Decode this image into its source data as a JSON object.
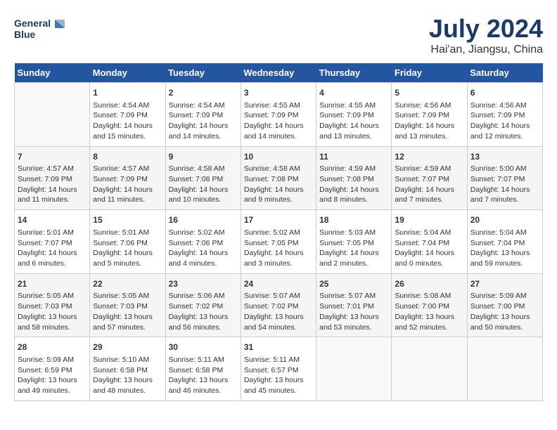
{
  "header": {
    "logo_line1": "General",
    "logo_line2": "Blue",
    "main_title": "July 2024",
    "subtitle": "Hai'an, Jiangsu, China"
  },
  "days_of_week": [
    "Sunday",
    "Monday",
    "Tuesday",
    "Wednesday",
    "Thursday",
    "Friday",
    "Saturday"
  ],
  "weeks": [
    [
      {
        "day": "",
        "content": ""
      },
      {
        "day": "1",
        "content": "Sunrise: 4:54 AM\nSunset: 7:09 PM\nDaylight: 14 hours and 15 minutes."
      },
      {
        "day": "2",
        "content": "Sunrise: 4:54 AM\nSunset: 7:09 PM\nDaylight: 14 hours and 14 minutes."
      },
      {
        "day": "3",
        "content": "Sunrise: 4:55 AM\nSunset: 7:09 PM\nDaylight: 14 hours and 14 minutes."
      },
      {
        "day": "4",
        "content": "Sunrise: 4:55 AM\nSunset: 7:09 PM\nDaylight: 14 hours and 13 minutes."
      },
      {
        "day": "5",
        "content": "Sunrise: 4:56 AM\nSunset: 7:09 PM\nDaylight: 14 hours and 13 minutes."
      },
      {
        "day": "6",
        "content": "Sunrise: 4:56 AM\nSunset: 7:09 PM\nDaylight: 14 hours and 12 minutes."
      }
    ],
    [
      {
        "day": "7",
        "content": "Sunrise: 4:57 AM\nSunset: 7:09 PM\nDaylight: 14 hours and 11 minutes."
      },
      {
        "day": "8",
        "content": "Sunrise: 4:57 AM\nSunset: 7:09 PM\nDaylight: 14 hours and 11 minutes."
      },
      {
        "day": "9",
        "content": "Sunrise: 4:58 AM\nSunset: 7:08 PM\nDaylight: 14 hours and 10 minutes."
      },
      {
        "day": "10",
        "content": "Sunrise: 4:58 AM\nSunset: 7:08 PM\nDaylight: 14 hours and 9 minutes."
      },
      {
        "day": "11",
        "content": "Sunrise: 4:59 AM\nSunset: 7:08 PM\nDaylight: 14 hours and 8 minutes."
      },
      {
        "day": "12",
        "content": "Sunrise: 4:59 AM\nSunset: 7:07 PM\nDaylight: 14 hours and 7 minutes."
      },
      {
        "day": "13",
        "content": "Sunrise: 5:00 AM\nSunset: 7:07 PM\nDaylight: 14 hours and 7 minutes."
      }
    ],
    [
      {
        "day": "14",
        "content": "Sunrise: 5:01 AM\nSunset: 7:07 PM\nDaylight: 14 hours and 6 minutes."
      },
      {
        "day": "15",
        "content": "Sunrise: 5:01 AM\nSunset: 7:06 PM\nDaylight: 14 hours and 5 minutes."
      },
      {
        "day": "16",
        "content": "Sunrise: 5:02 AM\nSunset: 7:06 PM\nDaylight: 14 hours and 4 minutes."
      },
      {
        "day": "17",
        "content": "Sunrise: 5:02 AM\nSunset: 7:05 PM\nDaylight: 14 hours and 3 minutes."
      },
      {
        "day": "18",
        "content": "Sunrise: 5:03 AM\nSunset: 7:05 PM\nDaylight: 14 hours and 2 minutes."
      },
      {
        "day": "19",
        "content": "Sunrise: 5:04 AM\nSunset: 7:04 PM\nDaylight: 14 hours and 0 minutes."
      },
      {
        "day": "20",
        "content": "Sunrise: 5:04 AM\nSunset: 7:04 PM\nDaylight: 13 hours and 59 minutes."
      }
    ],
    [
      {
        "day": "21",
        "content": "Sunrise: 5:05 AM\nSunset: 7:03 PM\nDaylight: 13 hours and 58 minutes."
      },
      {
        "day": "22",
        "content": "Sunrise: 5:05 AM\nSunset: 7:03 PM\nDaylight: 13 hours and 57 minutes."
      },
      {
        "day": "23",
        "content": "Sunrise: 5:06 AM\nSunset: 7:02 PM\nDaylight: 13 hours and 56 minutes."
      },
      {
        "day": "24",
        "content": "Sunrise: 5:07 AM\nSunset: 7:02 PM\nDaylight: 13 hours and 54 minutes."
      },
      {
        "day": "25",
        "content": "Sunrise: 5:07 AM\nSunset: 7:01 PM\nDaylight: 13 hours and 53 minutes."
      },
      {
        "day": "26",
        "content": "Sunrise: 5:08 AM\nSunset: 7:00 PM\nDaylight: 13 hours and 52 minutes."
      },
      {
        "day": "27",
        "content": "Sunrise: 5:09 AM\nSunset: 7:00 PM\nDaylight: 13 hours and 50 minutes."
      }
    ],
    [
      {
        "day": "28",
        "content": "Sunrise: 5:09 AM\nSunset: 6:59 PM\nDaylight: 13 hours and 49 minutes."
      },
      {
        "day": "29",
        "content": "Sunrise: 5:10 AM\nSunset: 6:58 PM\nDaylight: 13 hours and 48 minutes."
      },
      {
        "day": "30",
        "content": "Sunrise: 5:11 AM\nSunset: 6:58 PM\nDaylight: 13 hours and 46 minutes."
      },
      {
        "day": "31",
        "content": "Sunrise: 5:11 AM\nSunset: 6:57 PM\nDaylight: 13 hours and 45 minutes."
      },
      {
        "day": "",
        "content": ""
      },
      {
        "day": "",
        "content": ""
      },
      {
        "day": "",
        "content": ""
      }
    ]
  ]
}
